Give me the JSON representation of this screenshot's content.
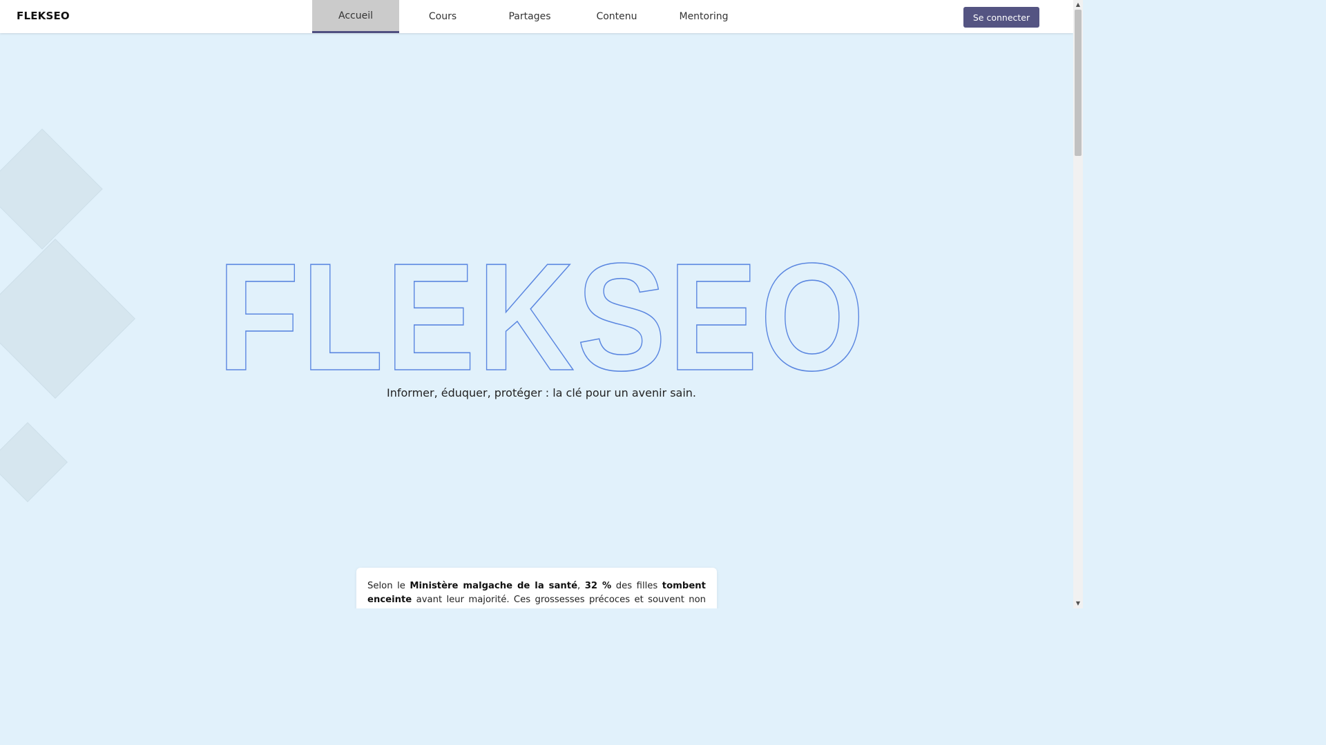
{
  "header": {
    "logo": "FLEKSEO",
    "nav": [
      {
        "label": "Accueil",
        "active": true
      },
      {
        "label": "Cours",
        "active": false
      },
      {
        "label": "Partages",
        "active": false
      },
      {
        "label": "Contenu",
        "active": false
      },
      {
        "label": "Mentoring",
        "active": false
      }
    ],
    "login_label": "Se connecter"
  },
  "hero": {
    "title": "FLEKSEO",
    "tagline": "Informer, éduquer, protéger : la clé pour un avenir sain."
  },
  "info_card": {
    "t1": "Selon le ",
    "b1": "Ministère malgache de la santé",
    "t2": ", ",
    "b2": "32 %",
    "t3": " des filles ",
    "b3": "tombent enceinte",
    "t4": " avant leur majorité. Ces grossesses précoces et souvent non désirées"
  },
  "colors": {
    "background": "#e1f1fb",
    "accent": "#545482",
    "outline": "#5a86e0",
    "diamond": "#d6e6ef"
  },
  "scrollbar": {
    "up_icon": "triangle-up-icon",
    "down_icon": "triangle-down-icon"
  }
}
